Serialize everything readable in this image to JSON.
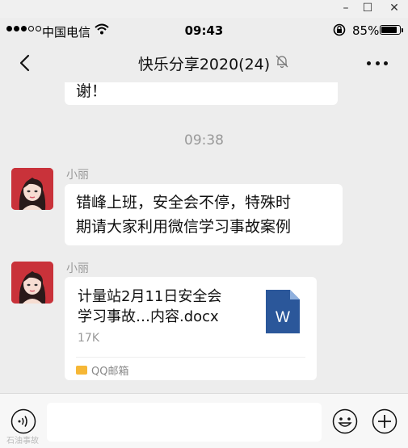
{
  "window": {
    "minimize": "–",
    "maximize": "☐",
    "close": "✕"
  },
  "status_bar": {
    "carrier": "中国电信",
    "time": "09:43",
    "battery_percent": "85%",
    "battery_level": 0.85,
    "signal_bars_filled": 3,
    "signal_bars_total": 5
  },
  "nav": {
    "title": "快乐分享2020(24)",
    "back_icon": "chevron-left-icon",
    "mute_icon": "bell-off-icon",
    "more_icon": "more-icon"
  },
  "chat": {
    "previous_message_tail": "谢！",
    "timestamp": "09:38",
    "messages": [
      {
        "sender": "小丽",
        "text_line1": "错峰上班，安全会不停，特殊时",
        "text_line2": "期请大家利用微信学习事故案例"
      },
      {
        "sender": "小丽",
        "file_line1": "计量站2月11日安全会",
        "file_line2": "学习事故…内容.docx",
        "file_size": "17K",
        "file_icon_letter": "W",
        "source": "QQ邮箱"
      }
    ]
  },
  "input_bar": {
    "voice_icon": "voice-icon",
    "emoji_icon": "emoji-icon",
    "plus_icon": "plus-icon",
    "watermark": "石油事故"
  },
  "colors": {
    "background": "#ededed",
    "bubble": "#ffffff",
    "word_blue": "#2b579a",
    "avatar_red": "#c9323a",
    "mail_yellow": "#f6b736"
  }
}
